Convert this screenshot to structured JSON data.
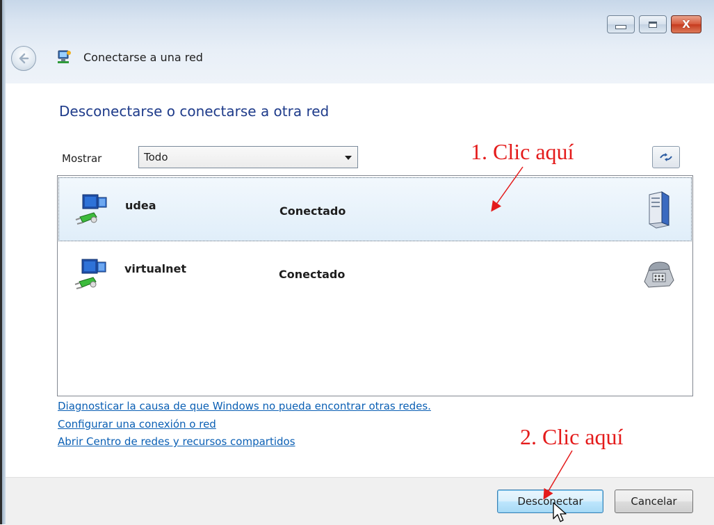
{
  "window": {
    "title": "Conectarse a una red",
    "controls": {
      "minimize": "minimize",
      "maximize": "maximize",
      "close": "X"
    }
  },
  "page": {
    "heading": "Desconectarse o conectarse a otra red",
    "filter": {
      "label": "Mostrar",
      "selected": "Todo"
    }
  },
  "networks": [
    {
      "name": "udea",
      "status": "Conectado",
      "type_icon": "server-icon",
      "selected": true
    },
    {
      "name": "virtualnet",
      "status": "Conectado",
      "type_icon": "phone-icon",
      "selected": false
    }
  ],
  "links": [
    "Diagnosticar la causa de que Windows no pueda encontrar otras redes.",
    "Configurar una conexión o red",
    "Abrir Centro de redes y recursos compartidos"
  ],
  "buttons": {
    "disconnect": "Desconectar",
    "cancel": "Cancelar"
  },
  "annotations": {
    "first": "1. Clic aquí",
    "second": "2. Clic aquí",
    "color": "#e41b1b"
  },
  "colors": {
    "heading": "#1e3b8a",
    "link": "#0a5fb4",
    "selection": "#e0eef9"
  }
}
